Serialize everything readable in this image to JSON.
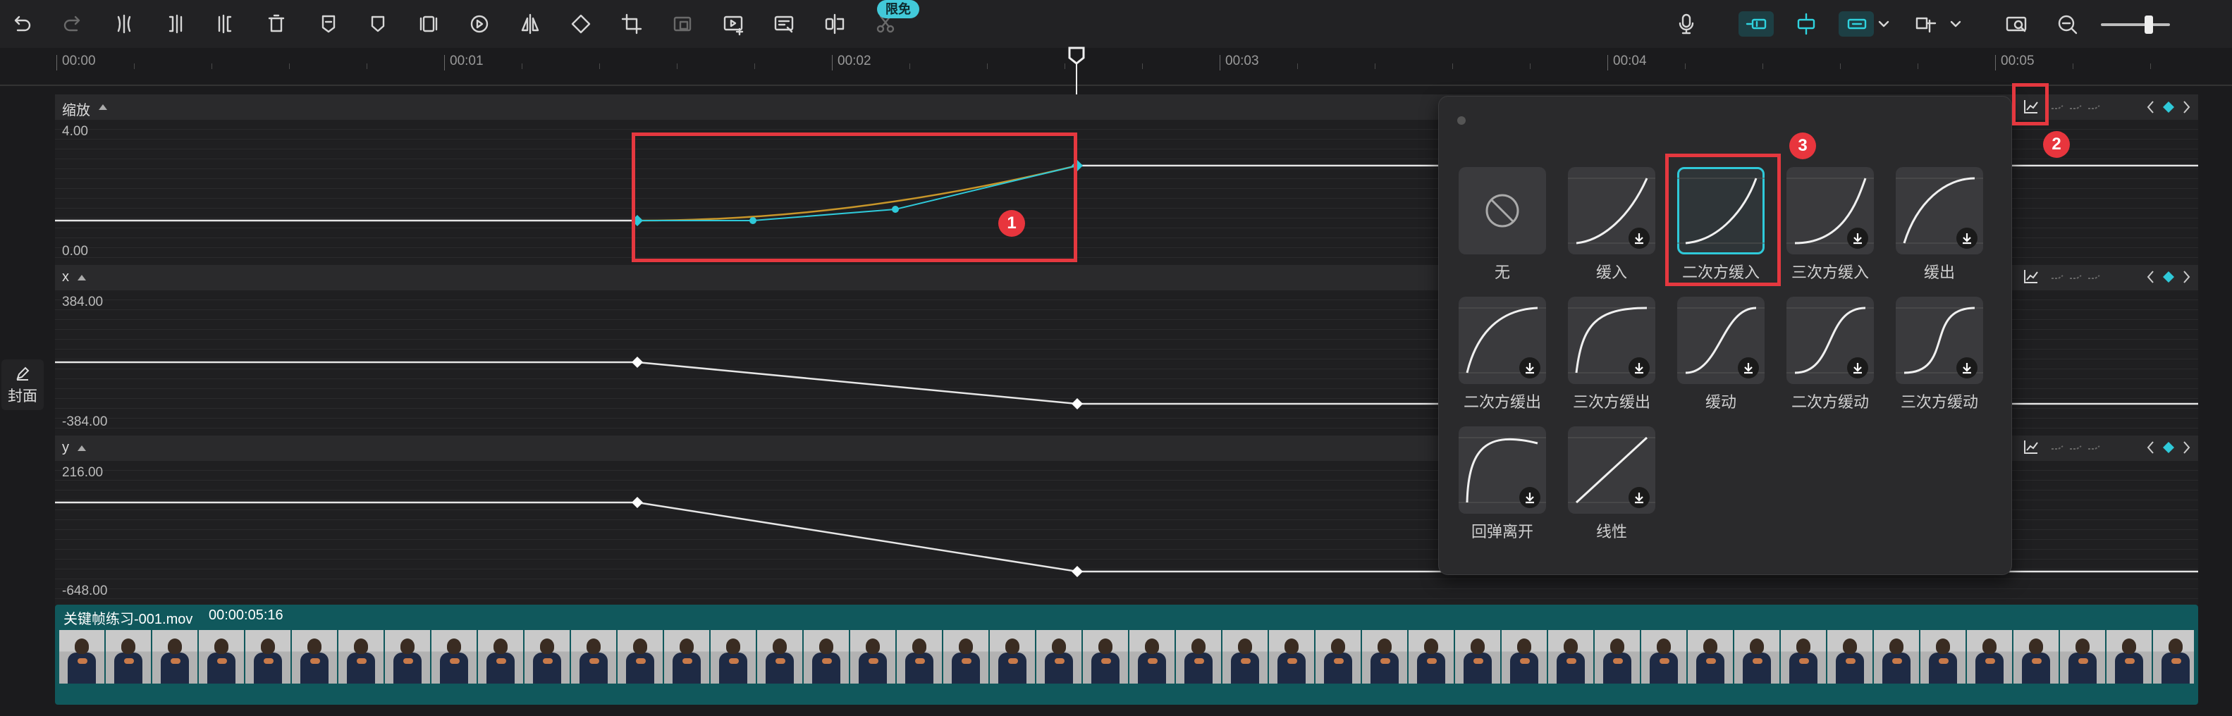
{
  "toolbar": {
    "left_icons": [
      "undo-icon",
      "redo-icon",
      "split-icon",
      "split-left-icon",
      "split-right-icon",
      "delete-icon",
      "marker-icon",
      "shield-icon",
      "freeze-frame-icon",
      "reverse-icon",
      "mirror-icon",
      "rotate-icon",
      "crop-icon",
      "crop-disabled-icon",
      "add-video-icon",
      "edit-icon",
      "trim-icon",
      "smart-cut-icon"
    ],
    "free_badge": "限免",
    "right_icons": [
      "microphone-icon",
      "link-main-track-icon",
      "snap-icon",
      "link-icon",
      "preview-axis-icon",
      "screenshot-icon",
      "zoom-out-icon"
    ],
    "zoom_level": 0.62
  },
  "ruler": {
    "labels": [
      "00:00",
      "00:01",
      "00:02",
      "00:03",
      "00:04",
      "00:05"
    ]
  },
  "sidebar": {
    "cover_label": "封面"
  },
  "lanes": [
    {
      "name": "缩放",
      "max": "4.00",
      "min": "0.00"
    },
    {
      "name": "x",
      "max": "384.00",
      "min": "-384.00"
    },
    {
      "name": "y",
      "max": "216.00",
      "min": "-648.00"
    }
  ],
  "clip": {
    "title": "关键帧练习-001.mov",
    "duration": "00:00:05:16"
  },
  "popup": {
    "presets": [
      {
        "label": "无",
        "curve": "none",
        "download": false
      },
      {
        "label": "缓入",
        "curve": "ease-in",
        "download": true
      },
      {
        "label": "二次方缓入",
        "curve": "quad-in",
        "download": false,
        "selected": true
      },
      {
        "label": "三次方缓入",
        "curve": "cubic-in",
        "download": true
      },
      {
        "label": "缓出",
        "curve": "ease-out",
        "download": true
      },
      {
        "label": "二次方缓出",
        "curve": "quad-out",
        "download": true
      },
      {
        "label": "三次方缓出",
        "curve": "cubic-out",
        "download": true
      },
      {
        "label": "缓动",
        "curve": "ease-in-out",
        "download": true
      },
      {
        "label": "二次方缓动",
        "curve": "quad-in-out",
        "download": true
      },
      {
        "label": "三次方缓动",
        "curve": "cubic-in-out",
        "download": true
      },
      {
        "label": "回弹离开",
        "curve": "back-out",
        "download": true
      },
      {
        "label": "线性",
        "curve": "linear",
        "download": true
      }
    ]
  },
  "annotations": {
    "badge1": "1",
    "badge2": "2",
    "badge3": "3"
  },
  "colors": {
    "accent": "#2fc9d9",
    "annotation": "#e5383f",
    "clip": "#10585c",
    "curve_orange": "#c8962a"
  }
}
